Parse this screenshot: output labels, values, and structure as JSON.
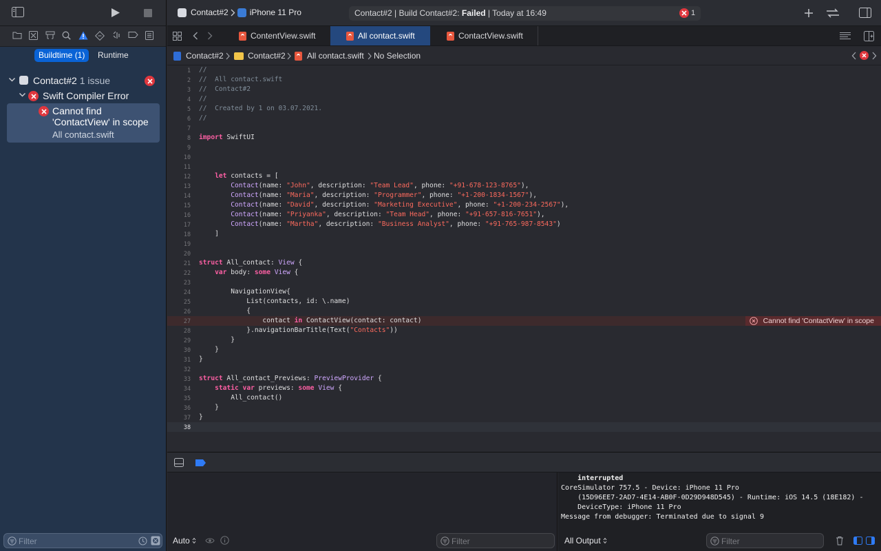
{
  "navigator": {
    "segments": [
      {
        "label": "Buildtime (1)"
      },
      {
        "label": "Runtime"
      }
    ],
    "project": {
      "name": "Contact#2",
      "issue_count": "1 issue"
    },
    "group": {
      "label": "Swift Compiler Error"
    },
    "issue": {
      "line1": "Cannot find",
      "line2": "'ContactView' in scope",
      "file": "All contact.swift"
    },
    "filter_placeholder": "Filter"
  },
  "toolbar": {
    "scheme": "Contact#2",
    "device": "iPhone 11 Pro",
    "status_prefix": "Contact#2 | Build Contact#2: ",
    "status_failed": "Failed",
    "status_suffix": " | Today at 16:49",
    "error_count": "1"
  },
  "tabs": [
    {
      "label": "ContentView.swift"
    },
    {
      "label": "All contact.swift"
    },
    {
      "label": "ContactView.swift"
    }
  ],
  "jumpbar": [
    "Contact#2",
    "Contact#2",
    "All contact.swift",
    "No Selection"
  ],
  "editor": {
    "lines": [
      [
        [
          "cm",
          "//"
        ]
      ],
      [
        [
          "cm",
          "//  All contact.swift"
        ]
      ],
      [
        [
          "cm",
          "//  Contact#2"
        ]
      ],
      [
        [
          "cm",
          "//"
        ]
      ],
      [
        [
          "cm",
          "//  Created by 1 on 03.07.2021."
        ]
      ],
      [
        [
          "cm",
          "//"
        ]
      ],
      [],
      [
        [
          "kw",
          "import"
        ],
        [
          "p",
          " SwiftUI"
        ]
      ],
      [],
      [],
      [],
      [
        [
          "p",
          "    "
        ],
        [
          "kw",
          "let"
        ],
        [
          "p",
          " contacts = ["
        ]
      ],
      [
        [
          "p",
          "        "
        ],
        [
          "ty",
          "Contact"
        ],
        [
          "p",
          "(name: "
        ],
        [
          "str",
          "\"John\""
        ],
        [
          "p",
          ", description: "
        ],
        [
          "str",
          "\"Team Lead\""
        ],
        [
          "p",
          ", phone: "
        ],
        [
          "str",
          "\"+91-678-123-8765\""
        ],
        [
          "p",
          "),"
        ]
      ],
      [
        [
          "p",
          "        "
        ],
        [
          "ty",
          "Contact"
        ],
        [
          "p",
          "(name: "
        ],
        [
          "str",
          "\"Maria\""
        ],
        [
          "p",
          ", description: "
        ],
        [
          "str",
          "\"Programmer\""
        ],
        [
          "p",
          ", phone: "
        ],
        [
          "str",
          "\"+1-200-1834-1567\""
        ],
        [
          "p",
          "),"
        ]
      ],
      [
        [
          "p",
          "        "
        ],
        [
          "ty",
          "Contact"
        ],
        [
          "p",
          "(name: "
        ],
        [
          "str",
          "\"David\""
        ],
        [
          "p",
          ", description: "
        ],
        [
          "str",
          "\"Marketing Executive\""
        ],
        [
          "p",
          ", phone: "
        ],
        [
          "str",
          "\"+1-200-234-2567\""
        ],
        [
          "p",
          "),"
        ]
      ],
      [
        [
          "p",
          "        "
        ],
        [
          "ty",
          "Contact"
        ],
        [
          "p",
          "(name: "
        ],
        [
          "str",
          "\"Priyanka\""
        ],
        [
          "p",
          ", description: "
        ],
        [
          "str",
          "\"Team Head\""
        ],
        [
          "p",
          ", phone: "
        ],
        [
          "str",
          "\"+91-657-816-7651\""
        ],
        [
          "p",
          "),"
        ]
      ],
      [
        [
          "p",
          "        "
        ],
        [
          "ty",
          "Contact"
        ],
        [
          "p",
          "(name: "
        ],
        [
          "str",
          "\"Martha\""
        ],
        [
          "p",
          ", description: "
        ],
        [
          "str",
          "\"Business Analyst\""
        ],
        [
          "p",
          ", phone: "
        ],
        [
          "str",
          "\"+91-765-987-8543\""
        ],
        [
          "p",
          ")"
        ]
      ],
      [
        [
          "p",
          "    ]"
        ]
      ],
      [],
      [],
      [
        [
          "kw",
          "struct"
        ],
        [
          "p",
          " All_contact: "
        ],
        [
          "ty",
          "View"
        ],
        [
          "p",
          " {"
        ]
      ],
      [
        [
          "p",
          "    "
        ],
        [
          "kw",
          "var"
        ],
        [
          "p",
          " body: "
        ],
        [
          "kw",
          "some"
        ],
        [
          "p",
          " "
        ],
        [
          "ty",
          "View"
        ],
        [
          "p",
          " {"
        ]
      ],
      [],
      [
        [
          "p",
          "        NavigationView{"
        ]
      ],
      [
        [
          "p",
          "            List(contacts, id: \\.name)"
        ]
      ],
      [
        [
          "p",
          "            {"
        ]
      ],
      [
        [
          "p",
          "                contact "
        ],
        [
          "kw",
          "in"
        ],
        [
          "p",
          " ContactView(contact: contact)"
        ]
      ],
      [
        [
          "p",
          "            }.navigationBarTitle(Text("
        ],
        [
          "str",
          "\"Contacts\""
        ],
        [
          "p",
          "))"
        ]
      ],
      [
        [
          "p",
          "        }"
        ]
      ],
      [
        [
          "p",
          "    }"
        ]
      ],
      [
        [
          "p",
          "}"
        ]
      ],
      [],
      [
        [
          "kw",
          "struct"
        ],
        [
          "p",
          " All_contact_Previews: "
        ],
        [
          "ty",
          "PreviewProvider"
        ],
        [
          "p",
          " {"
        ]
      ],
      [
        [
          "p",
          "    "
        ],
        [
          "kw",
          "static"
        ],
        [
          "p",
          " "
        ],
        [
          "kw",
          "var"
        ],
        [
          "p",
          " previews: "
        ],
        [
          "kw",
          "some"
        ],
        [
          "p",
          " "
        ],
        [
          "ty",
          "View"
        ],
        [
          "p",
          " {"
        ]
      ],
      [
        [
          "p",
          "        All_contact()"
        ]
      ],
      [
        [
          "p",
          "    }"
        ]
      ],
      [
        [
          "p",
          "}"
        ]
      ],
      []
    ],
    "error_line_index": 26,
    "current_line_index": 37,
    "inline_error": "Cannot find 'ContactView' in scope"
  },
  "debug": {
    "auto_label": "Auto",
    "var_filter_placeholder": "Filter",
    "console_filter_placeholder": "Filter",
    "output_label": "All Output",
    "console_lines": [
      "    interrupted",
      "CoreSimulator 757.5 - Device: iPhone 11 Pro",
      "    (15D96EE7-2AD7-4E14-AB0F-0D29D948D545) - Runtime: iOS 14.5 (18E182) -",
      "    DeviceType: iPhone 11 Pro",
      "Message from debugger: Terminated due to signal 9"
    ]
  },
  "colors": {
    "accent": "#0a63d6",
    "error": "#e0373e",
    "sidebar": "#23344b",
    "editor_bg": "#292a30"
  }
}
